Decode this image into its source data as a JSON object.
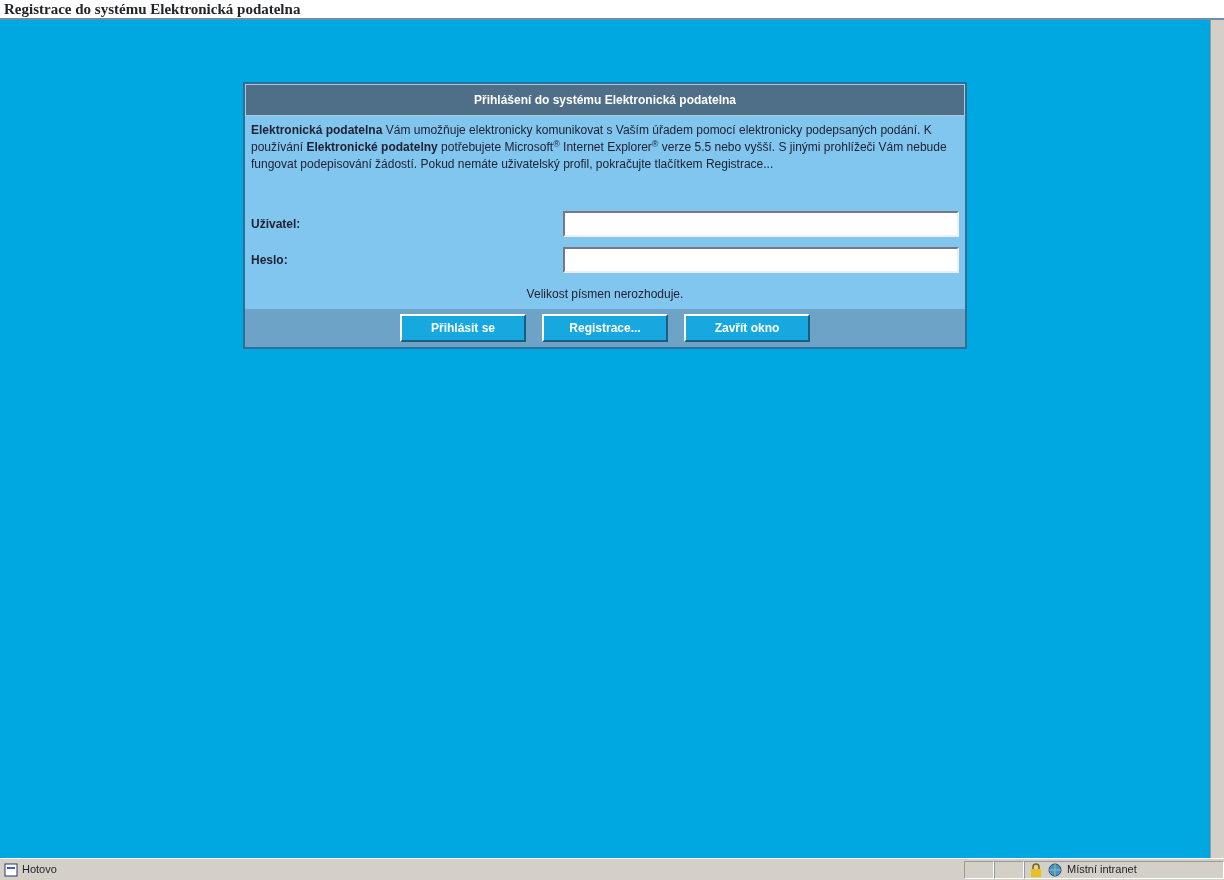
{
  "page_title": "Registrace do systému Elektronická podatelna",
  "dialog": {
    "title": "Přihlášení do systému Elektronická podatelna",
    "intro": "**Elektronická podatelna** Vám umožňuje elektronicky komunikovat s Vaším úřadem pomocí elektronicky podepsaných podání. K používání **Elektronické podatelny** potřebujete Microsoft$^{®}$ Internet Explorer$^{®}$ verze 5.5 nebo vyšší. S jinými prohlížeči Vám nebude fungovat podepisování žádostí. Pokud nemáte uživatelský profil, pokračujte tlačítkem Registrace...",
    "fields": [
      {
        "label": "Uživatel:"
      },
      {
        "label": "Heslo:"
      }
    ],
    "note": "Velikost písmen nerozhoduje.",
    "buttons": [
      "Přihlásit se",
      "Registrace...",
      "Zavřít okno"
    ]
  },
  "status_bar": {
    "text": "Hotovo",
    "zone": "Místní intranet"
  }
}
